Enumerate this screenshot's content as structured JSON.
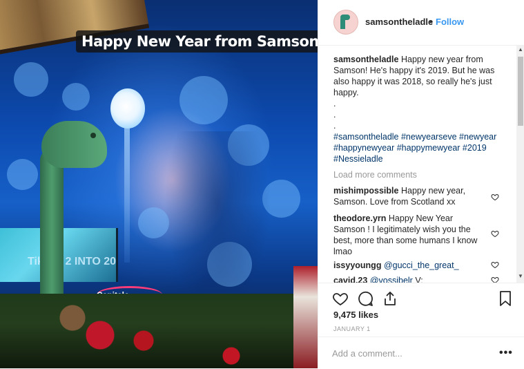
{
  "photo": {
    "overlay_text": "Happy New Year from Samson!",
    "tv_text": "TikTok  2  INTO 20",
    "logo_text": "Capitalo"
  },
  "post": {
    "username": "samsontheladle",
    "dot": "•",
    "follow_label": "Follow",
    "caption_user": "samsontheladle",
    "caption_text": "Happy new year from Samson! He's happy it's 2019. But he was also happy it was 2018, so really he's just happy.",
    "caption_dots": [
      ".",
      ".",
      "."
    ],
    "hashtags": "#samsontheladle #newyearseve #newyear #happynewyear #happymewyear #2019 #Nessieladle",
    "load_more": "Load more comments",
    "comments": [
      {
        "user": "mishimpossible",
        "text": "Happy new year, Samson. Love from Scotland xx"
      },
      {
        "user": "theodore.yrn",
        "text": "Happy New Year Samson ! I legitimately wish you the best, more than some humans I know lmao"
      },
      {
        "user": "issyyoungg",
        "mention": "@gucci_the_great_",
        "text": ""
      },
      {
        "user": "cavid.23",
        "mention": "@vossibelr",
        "text": "V:"
      }
    ],
    "likes": "9,475 likes",
    "date": "JANUARY 1",
    "add_comment_placeholder": "Add a comment...",
    "more_options": "•••"
  },
  "colors": {
    "link": "#3897f0",
    "hashtag": "#003569",
    "muted": "#999999",
    "text": "#262626"
  },
  "icons": [
    "heart-icon",
    "comment-icon",
    "share-icon",
    "bookmark-icon",
    "small-heart-icon",
    "more-options-icon"
  ]
}
